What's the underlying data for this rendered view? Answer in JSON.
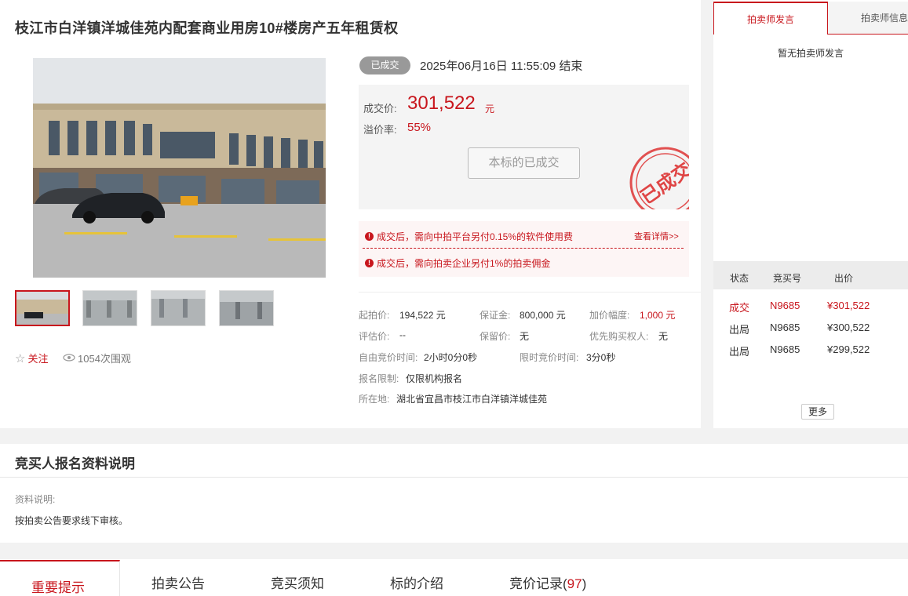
{
  "auction": {
    "title": "枝江市白洋镇洋城佳苑内配套商业用房10#楼房产五年租赁权",
    "status": "已成交",
    "end_time": "2025年06月16日  11:55:09 结束",
    "deal_price_label": "成交价:",
    "deal_price": "301,522",
    "deal_unit": "元",
    "premium_label": "溢价率:",
    "premium": "55%",
    "done_button": "本标的已成交",
    "stamp_text": "已成交",
    "notices": [
      "成交后，需向中拍平台另付0.15%的软件使用费",
      "成交后，需向拍卖企业另付1%的拍卖佣金"
    ],
    "details_link": "查看详情>>",
    "follow": "关注",
    "views": "1054次围观"
  },
  "info": {
    "start_price": {
      "label": "起拍价:",
      "value": "194,522 元"
    },
    "deposit": {
      "label": "保证金:",
      "value": "800,000 元"
    },
    "increment": {
      "label": "加价幅度:",
      "value": "1,000 元"
    },
    "assessed": {
      "label": "评估价:",
      "value": "--"
    },
    "reserve": {
      "label": "保留价:",
      "value": "无"
    },
    "priority": {
      "label": "优先购买权人:",
      "value": "无"
    },
    "free_time": {
      "label": "自由竞价时间:",
      "value": "2小时0分0秒"
    },
    "limit_time": {
      "label": "限时竞价时间:",
      "value": "3分0秒"
    },
    "registration": {
      "label": "报名限制:",
      "value": "仅限机构报名"
    },
    "location": {
      "label": "所在地:",
      "value": "湖北省宜昌市枝江市白洋镇洋城佳苑"
    }
  },
  "side": {
    "tab_active": "拍卖师发言",
    "tab_2": "拍卖师信息",
    "no_remarks": "暂无拍卖师发言",
    "columns": [
      "状态",
      "竞买号",
      "出价"
    ],
    "bids": [
      {
        "status": "成交",
        "number": "N9685",
        "price": "¥301,522",
        "win": true
      },
      {
        "status": "出局",
        "number": "N9685",
        "price": "¥300,522",
        "win": false
      },
      {
        "status": "出局",
        "number": "N9685",
        "price": "¥299,522",
        "win": false
      }
    ],
    "more": "更多"
  },
  "section": {
    "title": "竞买人报名资料说明",
    "label": "资料说明:",
    "text": "按拍卖公告要求线下审核。"
  },
  "tabs": {
    "items": [
      "重要提示",
      "拍卖公告",
      "竞买须知",
      "标的介绍",
      "竞价记录"
    ],
    "record_count": "97"
  },
  "colors": {
    "accent": "#c8161d",
    "pill": "#999999"
  }
}
